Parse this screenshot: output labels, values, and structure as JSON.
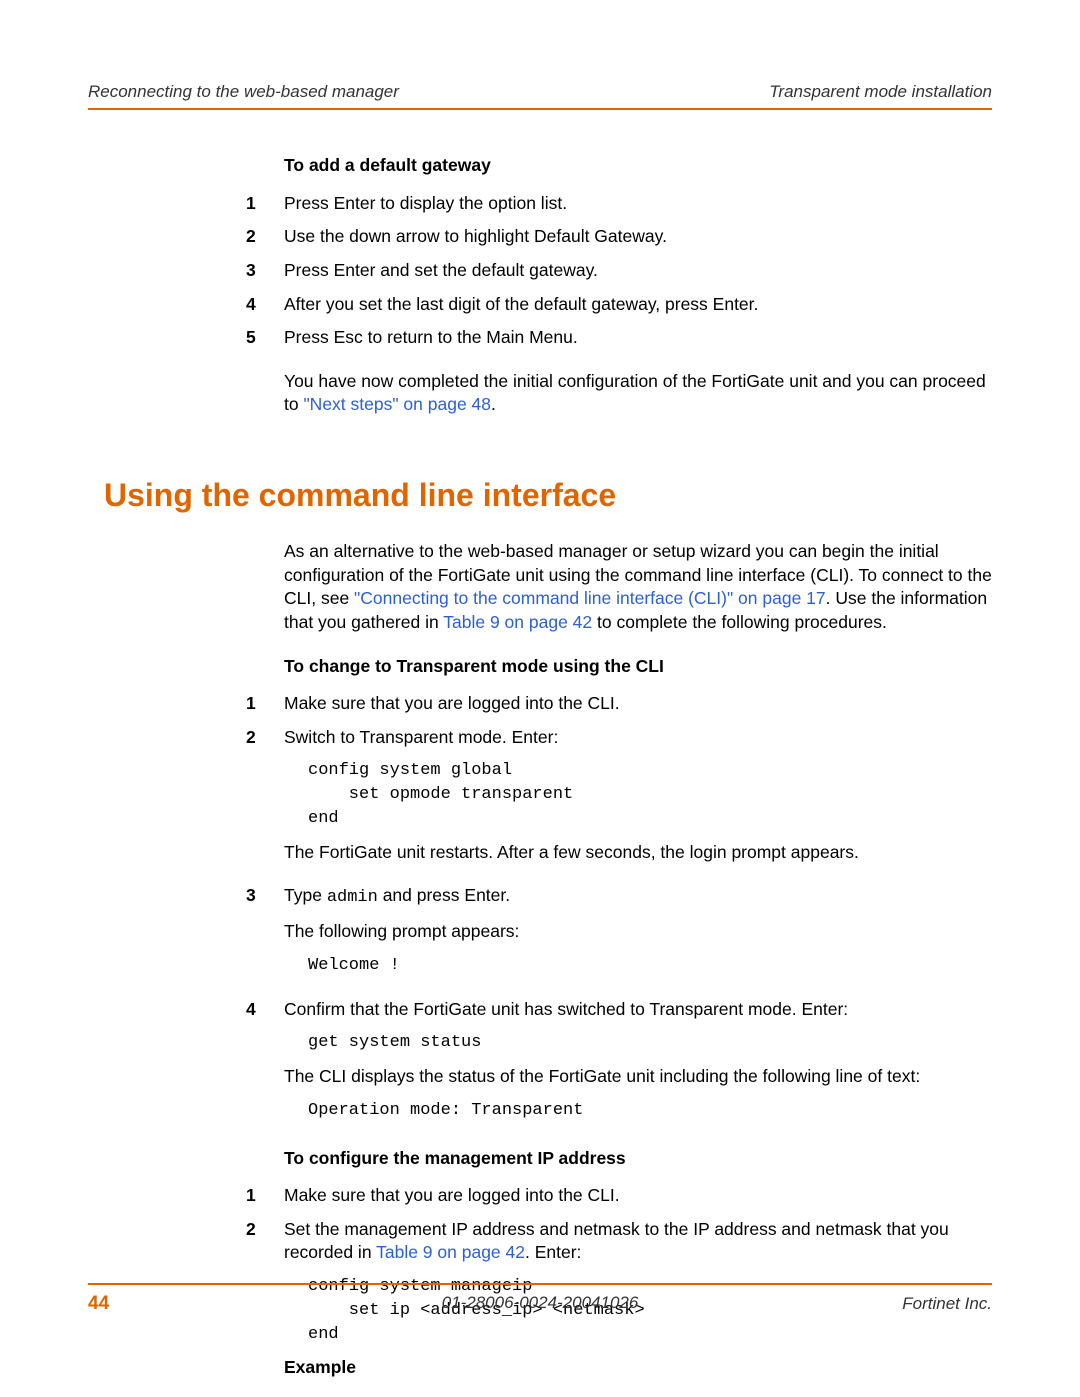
{
  "header": {
    "left": "Reconnecting to the web-based manager",
    "right": "Transparent mode installation"
  },
  "section1": {
    "title": "To add a default gateway",
    "steps": {
      "s1_num": "1",
      "s1": "Press Enter to display the option list.",
      "s2_num": "2",
      "s2": "Use the down arrow to highlight Default Gateway.",
      "s3_num": "3",
      "s3": "Press Enter and set the default gateway.",
      "s4_num": "4",
      "s4": "After you set the last digit of the default gateway, press Enter.",
      "s5_num": "5",
      "s5": "Press Esc to return to the Main Menu.",
      "followup_a": "You have now completed the initial configuration of the FortiGate unit and you can proceed to ",
      "followup_link": "\"Next steps\" on page 48",
      "followup_b": "."
    }
  },
  "h1": "Using the command line interface",
  "intro": {
    "a": "As an alternative to the web-based manager or setup wizard you can begin the initial configuration of the FortiGate unit using the command line interface (CLI). To connect to the CLI, see ",
    "link1": "\"Connecting to the command line interface (CLI)\" on page 17",
    "b": ". Use the information that you gathered in ",
    "link2": "Table 9 on page 42",
    "c": " to complete the following procedures."
  },
  "section2": {
    "title": "To change to Transparent mode using the CLI",
    "s1_num": "1",
    "s1": "Make sure that you are logged into the CLI.",
    "s2_num": "2",
    "s2": "Switch to Transparent mode. Enter:",
    "code1": "config system global\n    set opmode transparent\nend",
    "after_code1": "The FortiGate unit restarts. After a few seconds, the login prompt appears.",
    "s3_num": "3",
    "s3_a": "Type ",
    "s3_mono": "admin",
    "s3_b": " and press Enter.",
    "s3_follow": "The following prompt appears:",
    "code2": "Welcome !",
    "s4_num": "4",
    "s4": "Confirm that the FortiGate unit has switched to Transparent mode. Enter:",
    "code3": "get system status",
    "after_code3": "The CLI displays the status of the FortiGate unit including the following line of text:",
    "code4": "Operation mode: Transparent"
  },
  "section3": {
    "title": "To configure the management IP address",
    "s1_num": "1",
    "s1": "Make sure that you are logged into the CLI.",
    "s2_num": "2",
    "s2_a": "Set the management IP address and netmask to the IP address and netmask that you recorded in ",
    "s2_link": "Table 9 on page 42",
    "s2_b": ". Enter:",
    "code1": "config system manageip\n    set ip <address_ip> <netmask>\nend",
    "example": "Example"
  },
  "footer": {
    "page": "44",
    "center": "01-28006-0024-20041026",
    "right": "Fortinet Inc."
  }
}
